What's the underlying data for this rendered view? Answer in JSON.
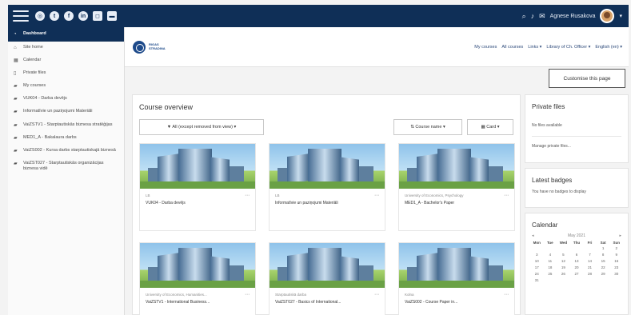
{
  "topbar": {
    "social_icons": [
      "globe-icon",
      "twitter-icon",
      "facebook-icon",
      "linkedin-icon",
      "instagram-icon",
      "chat-icon"
    ],
    "user_name": "Agnese Rusakova"
  },
  "sidebar": {
    "items": [
      {
        "label": "Dashboard",
        "icon": "gauge-icon",
        "active": true
      },
      {
        "label": "Site home",
        "icon": "home-icon",
        "active": false
      },
      {
        "label": "Calendar",
        "icon": "calendar-icon",
        "active": false
      },
      {
        "label": "Private files",
        "icon": "file-icon",
        "active": false
      },
      {
        "label": "My courses",
        "icon": "graduation-icon",
        "active": false
      },
      {
        "label": "VUK04 - Darba devējs",
        "icon": "graduation-icon",
        "active": false
      },
      {
        "label": "Informatīvie un paziņojumi Materiāli",
        "icon": "graduation-icon",
        "active": false
      },
      {
        "label": "VaiZSTV1 - Starptautiskās biznesa stratēģijas",
        "icon": "graduation-icon",
        "active": false
      },
      {
        "label": "MED1_A - Bakalaura darbs",
        "icon": "graduation-icon",
        "active": false
      },
      {
        "label": "VaiZS002 - Kursa darbs starptautiskajā biznesā",
        "icon": "graduation-icon",
        "active": false
      },
      {
        "label": "VaiZST027 - Starptautiskās organizācijas biznesa vidē",
        "icon": "graduation-icon",
        "active": false
      }
    ]
  },
  "header": {
    "logo_text": "RIGAS\nSTRADINA",
    "nav": [
      "My courses",
      "All courses",
      "Links ▾",
      "Library of Ch. Officer ▾",
      "English (en) ▾"
    ]
  },
  "customize_label": "Customise this page",
  "overview": {
    "title": "Course overview",
    "filter_label": "▼ All (except removed from view) ▾",
    "sort_label": "⇅ Course name ▾",
    "view_label": "▦ Card ▾",
    "courses": [
      {
        "category": "LB",
        "name": "VUK04 - Darba devējs"
      },
      {
        "category": "LB",
        "name": "Informatīvie un paziņojumi Materiāli"
      },
      {
        "category": "University of Economics, Psychology",
        "name": "MED1_A - Bachelor's Paper"
      },
      {
        "category": "University of Economics, Humanities...",
        "name": "VaiZSTV1 - International Business..."
      },
      {
        "category": "Starptautiskā darba",
        "name": "VaiZST027 - Basics of International..."
      },
      {
        "category": "Kolna",
        "name": "VaiZS002 - Course Paper in..."
      }
    ]
  },
  "private_files": {
    "title": "Private files",
    "empty": "No files available",
    "manage": "Manage private files..."
  },
  "latest_badges": {
    "title": "Latest badges",
    "empty": "You have no badges to display"
  },
  "calendar": {
    "title": "Calendar",
    "prev": "◂",
    "month": "May 2021",
    "next": "▸",
    "days": [
      "Mon",
      "Tue",
      "Wed",
      "Thu",
      "Fri",
      "Sat",
      "Sun"
    ],
    "dates": [
      "",
      "",
      "",
      "",
      "",
      "1",
      "2",
      "3",
      "4",
      "5",
      "6",
      "7",
      "8",
      "9",
      "10",
      "11",
      "12",
      "13",
      "14",
      "15",
      "16",
      "17",
      "18",
      "19",
      "20",
      "21",
      "22",
      "23",
      "24",
      "25",
      "26",
      "27",
      "28",
      "29",
      "30",
      "31"
    ]
  }
}
